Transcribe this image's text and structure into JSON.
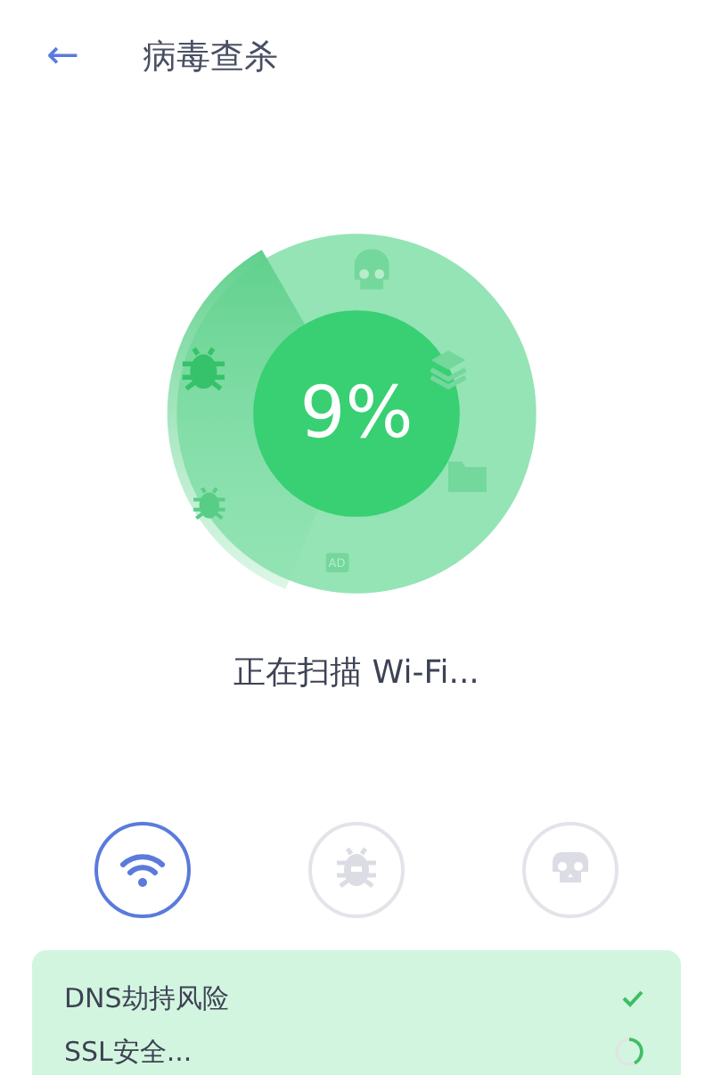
{
  "header": {
    "back_icon": "←",
    "title": "病毒查杀"
  },
  "dial": {
    "percent": "9%",
    "ad_label": "AD"
  },
  "status_text": "正在扫描 Wi-Fi...",
  "categories": [
    {
      "kind": "wifi",
      "selected": true
    },
    {
      "kind": "bug",
      "selected": false
    },
    {
      "kind": "skull",
      "selected": false
    }
  ],
  "checks": [
    {
      "label": "DNS劫持风险",
      "done": true
    },
    {
      "label": "SSL安全...",
      "done": false
    }
  ]
}
